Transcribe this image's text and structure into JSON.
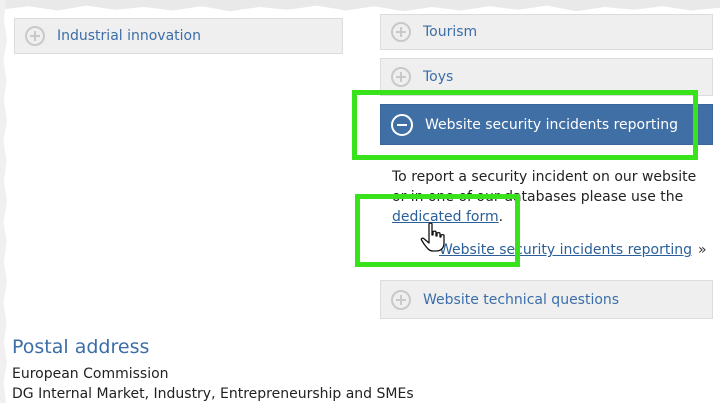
{
  "accordion_left": {
    "label": "Industrial innovation"
  },
  "accordion_right": {
    "tourism": "Tourism",
    "toys": "Toys",
    "security": "Website security incidents reporting",
    "technical": "Website technical questions"
  },
  "security_panel": {
    "text_before": "To report a security incident on our website or in one of our databases please use the ",
    "link_text": "dedicated form",
    "text_after": ".",
    "more_link": "Website security incidents reporting",
    "more_arrow": "»"
  },
  "postal": {
    "title": "Postal address",
    "line1": "European Commission",
    "line2": "DG Internal Market, Industry, Entrepreneurship and SMEs"
  },
  "colors": {
    "accent": "#3b6ea8",
    "active_bg": "#3f6fa4",
    "highlight": "#39e31b"
  }
}
